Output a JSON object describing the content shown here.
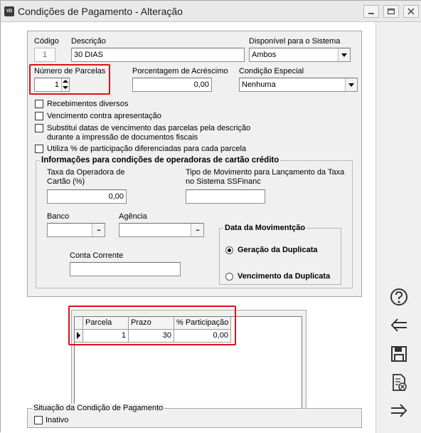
{
  "window": {
    "title": "Condições de Pagamento - Alteração",
    "icon_text": "VD"
  },
  "form": {
    "codigo": {
      "label": "Código",
      "value": "1"
    },
    "descricao": {
      "label": "Descrição",
      "value": "30 DIAS"
    },
    "sistema": {
      "label": "Disponível para o Sistema",
      "value": "Ambos"
    },
    "parcelas": {
      "label": "Número de Parcelas",
      "value": "1"
    },
    "acrescimo": {
      "label": "Porcentagem de Acréscimo",
      "value": "0,00"
    },
    "condicao": {
      "label": "Condição Especial",
      "value": "Nenhuma"
    },
    "checks": [
      {
        "label": "Recebimentos diversos",
        "checked": false
      },
      {
        "label": "Vencimento contra apresentação",
        "checked": false
      },
      {
        "label": "Substitui datas de vencimento das parcelas pela descrição",
        "label2": "durante a impressão de documentos fiscais",
        "checked": false
      },
      {
        "label": "Utiliza % de participação diferenciadas para cada parcela",
        "checked": false
      }
    ]
  },
  "cartao": {
    "title": "Informações para condições de operadoras de cartão crédito",
    "taxa_label1": "Taxa da Operadora de",
    "taxa_label2": "Cartão (%)",
    "taxa_value": "0,00",
    "tipo_label1": "Tipo de Movimento para Lançamento da Taxa",
    "tipo_label2": "no Sistema SSFinanc",
    "tipo_value": "",
    "banco_label": "Banco",
    "agencia_label": "Agência",
    "conta_label": "Conta Corrente",
    "lookup_glyph": "...",
    "movimentacao": {
      "title": "Data da Movimentção",
      "options": [
        {
          "label": "Geração da Duplicata",
          "selected": true
        },
        {
          "label": "Vencimento da Duplicata",
          "selected": false
        }
      ]
    }
  },
  "grid": {
    "headers": [
      "Parcela",
      "Prazo",
      "% Participação"
    ],
    "rows": [
      {
        "parcela": "1",
        "prazo": "30",
        "participacao": "0,00"
      }
    ]
  },
  "situacao": {
    "title": "Situação da Condição de Pagamento",
    "inativo_label": "Inativo",
    "inativo_checked": false
  },
  "toolbar": {
    "help_icon": "question-circle",
    "back_icon": "arrow-left",
    "save_icon": "floppy-disk",
    "cancel_icon": "document-x",
    "next_icon": "arrow-right"
  },
  "colors": {
    "highlight": "#e0101a",
    "panel": "#f0f0f0"
  }
}
